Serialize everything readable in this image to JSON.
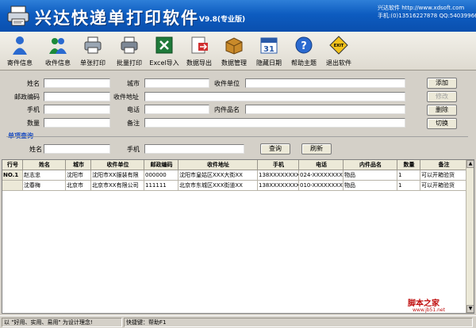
{
  "banner": {
    "title": "兴达快递单打印软件",
    "version": "V9.8(专业版)",
    "brand_line1": "兴达软件   http://www.xdsoft.com",
    "brand_line2": "手机:(0)13516227878  QQ:540399662"
  },
  "toolbar": [
    {
      "label": "寄件信息",
      "icon": "user-icon"
    },
    {
      "label": "收件信息",
      "icon": "users-icon"
    },
    {
      "label": "单张打印",
      "icon": "printer-icon"
    },
    {
      "label": "批量打印",
      "icon": "printer-icon"
    },
    {
      "label": "Excel导入",
      "icon": "excel-icon"
    },
    {
      "label": "数据导出",
      "icon": "export-icon"
    },
    {
      "label": "数据管理",
      "icon": "box-icon"
    },
    {
      "label": "隐藏日期",
      "icon": "calendar-icon"
    },
    {
      "label": "帮助主题",
      "icon": "help-icon"
    },
    {
      "label": "退出软件",
      "icon": "exit-icon"
    }
  ],
  "calendar_day": "31",
  "exit_sign": "EXIT",
  "form": {
    "name_label": "姓名",
    "city_label": "城市",
    "unit_label": "收件单位",
    "zip_label": "邮政编码",
    "address_label": "收件地址",
    "mobile_label": "手机",
    "phone_label": "电话",
    "item_label": "内件品名",
    "qty_label": "数量",
    "remark_label": "备注",
    "add_button": "添加",
    "modify_button": "修改",
    "delete_button": "删除",
    "toggle_button": "切换"
  },
  "query": {
    "section_title": "单项查询",
    "name_label": "姓名",
    "mobile_label": "手机",
    "query_button": "查询",
    "refresh_button": "刷新"
  },
  "table": {
    "columns": [
      "行号",
      "姓名",
      "城市",
      "收件单位",
      "邮政编码",
      "收件地址",
      "手机",
      "电话",
      "内件品名",
      "数量",
      "备注"
    ],
    "rows": [
      [
        "NO.1",
        "赵志忠",
        "沈阳市",
        "沈阳市XX服装有限",
        "000000",
        "沈阳市皇姑区XXX大街XX",
        "138XXXXXXXX",
        "024-XXXXXXXX",
        "物品",
        "1",
        "可以开箱验货"
      ],
      [
        "",
        "沈春梅",
        "北京市",
        "北京市XX有限公司",
        "111111",
        "北京市东城区XXX街道XX",
        "138XXXXXXXX",
        "010-XXXXXXXX",
        "物品",
        "1",
        "可以开箱验货"
      ]
    ]
  },
  "watermark": "脚本之家",
  "watermark_url": "www.jb51.net",
  "status": {
    "slogan": "以 \"好用、实用、易用\" 为设计理念!",
    "shortcut": "快捷键：帮助F1"
  }
}
